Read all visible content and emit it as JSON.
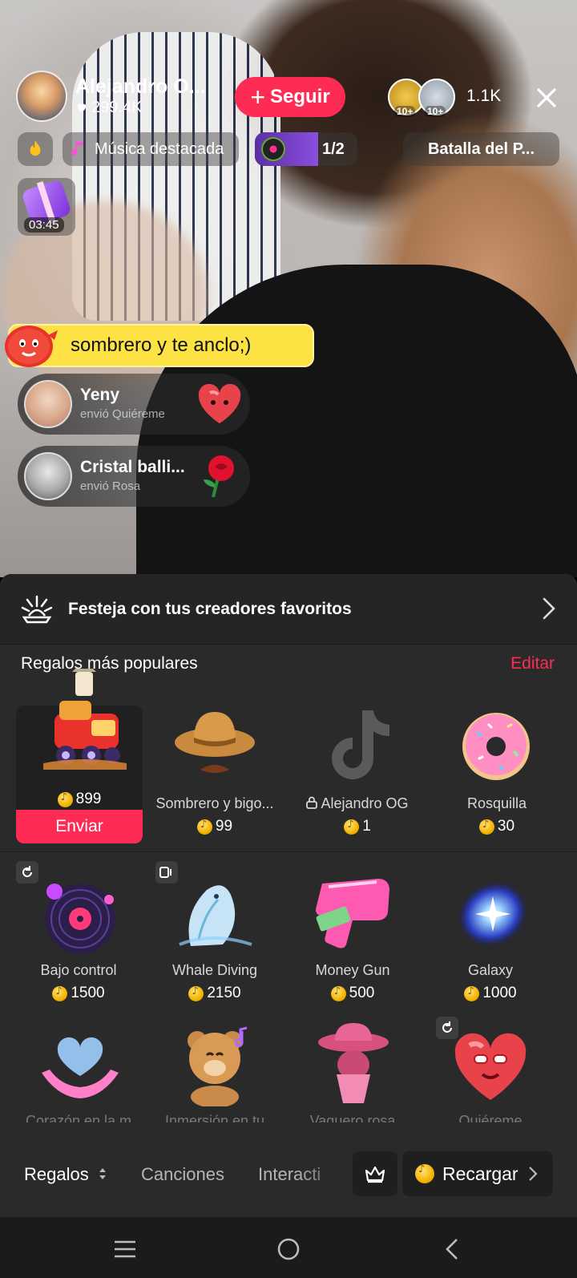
{
  "stream": {
    "host_name": "Alejandro O...",
    "host_likes": "299.4K",
    "follow_label": "Seguir",
    "viewer_badges": [
      "10+",
      "10+"
    ],
    "viewer_count": "1.1K"
  },
  "pills": {
    "music_label": "Música destacada",
    "page_label": "1/2",
    "battle_label": "Batalla del P..."
  },
  "timer": "03:45",
  "comment": "sombrero y te anclo;)",
  "notifications": [
    {
      "name": "Yeny",
      "action": "envió Quiéreme",
      "gift_icon": "heart-gift-icon"
    },
    {
      "name": "Cristal balli...",
      "action": "envió Rosa",
      "gift_icon": "rose-icon"
    }
  ],
  "panel": {
    "banner_text": "Festeja con tus creadores favoritos",
    "section_title": "Regalos más populares",
    "edit_label": "Editar",
    "send_label": "Enviar",
    "gifts": [
      {
        "name": "",
        "price": "899",
        "icon": "train-gift-icon"
      },
      {
        "name": "Sombrero y bigo...",
        "price": "99",
        "icon": "cowboy-hat-icon"
      },
      {
        "name": "Alejandro OG",
        "price": "1",
        "icon": "tiktok-logo-icon"
      },
      {
        "name": "Rosquilla",
        "price": "30",
        "icon": "donut-icon"
      },
      {
        "name": "Bajo control",
        "price": "1500",
        "icon": "vinyl-record-icon"
      },
      {
        "name": "Whale Diving",
        "price": "2150",
        "icon": "whale-icon"
      },
      {
        "name": "Money Gun",
        "price": "500",
        "icon": "money-gun-icon"
      },
      {
        "name": "Galaxy",
        "price": "1000",
        "icon": "galaxy-icon"
      },
      {
        "name": "Corazón en la m",
        "icon": "heart-hands-icon"
      },
      {
        "name": "Inmersión en tu",
        "icon": "teddy-bear-icon"
      },
      {
        "name": "Vaquero rosa",
        "icon": "pink-cowboy-icon"
      },
      {
        "name": "Quiéreme",
        "icon": "heart-gift-icon"
      }
    ]
  },
  "tabs": {
    "gifts": "Regalos",
    "songs": "Canciones",
    "interactive": "Interacti",
    "recharge": "Recargar"
  },
  "colors": {
    "accent": "#fe2c55",
    "comment_bg": "#fce243",
    "panel_bg": "#2a2a2a"
  }
}
